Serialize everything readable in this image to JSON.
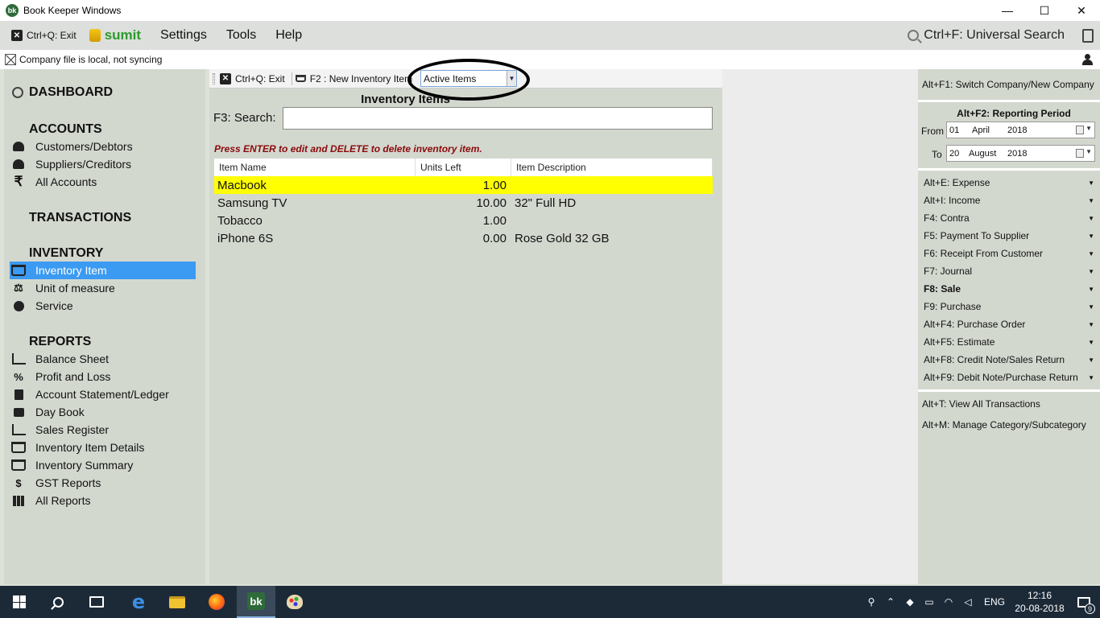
{
  "window": {
    "title": "Book Keeper Windows",
    "app_icon": "bk",
    "minimize": "—",
    "maximize": "☐",
    "close": "✕"
  },
  "menubar": {
    "exit_label": "Ctrl+Q: Exit",
    "company": "sumit",
    "items": [
      "Settings",
      "Tools",
      "Help"
    ],
    "universal_search": "Ctrl+F: Universal Search"
  },
  "syncbar": {
    "status": "Company file is local, not syncing"
  },
  "sidebar": {
    "dashboard": "DASHBOARD",
    "accounts_heading": "ACCOUNTS",
    "accounts_items": [
      "Customers/Debtors",
      "Suppliers/Creditors",
      "All Accounts"
    ],
    "transactions_heading": "TRANSACTIONS",
    "inventory_heading": "INVENTORY",
    "inventory_items": [
      "Inventory Item",
      "Unit of measure",
      "Service"
    ],
    "reports_heading": "REPORTS",
    "reports_items": [
      "Balance Sheet",
      "Profit and Loss",
      "Account Statement/Ledger",
      "Day Book",
      "Sales Register",
      "Inventory Item Details",
      "Inventory Summary",
      "GST Reports",
      "All Reports"
    ],
    "rupee_symbol": "₹",
    "percent_symbol": "%",
    "scale_symbol": "⚖",
    "money_symbol": "$"
  },
  "inventory": {
    "toolbar_exit": "Ctrl+Q: Exit",
    "toolbar_new": "F2 : New Inventory Item",
    "filter_selected": "Active Items",
    "title": "Inventory Items",
    "search_label": "F3: Search:",
    "search_value": "",
    "hint": "Press ENTER to edit and DELETE to delete inventory item.",
    "columns": [
      "Item Name",
      "Units Left",
      "Item Description"
    ],
    "rows": [
      {
        "name": "Macbook",
        "units": "1.00",
        "desc": ""
      },
      {
        "name": "Samsung TV",
        "units": "10.00",
        "desc": "32\" Full HD"
      },
      {
        "name": "Tobacco",
        "units": "1.00",
        "desc": ""
      },
      {
        "name": "iPhone 6S",
        "units": "0.00",
        "desc": "Rose Gold 32 GB"
      }
    ],
    "highlight_color": "#ffff00"
  },
  "right_panel": {
    "switch_company": "Alt+F1: Switch Company/New Company",
    "period_title": "Alt+F2: Reporting Period",
    "from_label": "From",
    "from_day": "01",
    "from_month": "April",
    "from_year": "2018",
    "to_label": "To",
    "to_day": "20",
    "to_month": "August",
    "to_year": "2018",
    "actions": [
      "Alt+E: Expense",
      "Alt+I: Income",
      "F4: Contra",
      "F5: Payment To Supplier",
      "F6: Receipt From Customer",
      "F7: Journal",
      "F8: Sale",
      "F9: Purchase",
      "Alt+F4: Purchase Order",
      "Alt+F5: Estimate",
      "Alt+F8: Credit Note/Sales Return",
      "Alt+F9: Debit Note/Purchase Return"
    ],
    "view_all": "Alt+T: View All Transactions",
    "manage_category": "Alt+M: Manage Category/Subcategory"
  },
  "taskbar": {
    "bk_label": "bk",
    "edge_label": "e",
    "language": "ENG",
    "time": "12:16",
    "date": "20-08-2018",
    "notification_count": "9"
  },
  "colors": {
    "selected_nav": "#3b9af2",
    "company_name": "#2d9a2d",
    "hint_text": "#8a0a0a"
  }
}
